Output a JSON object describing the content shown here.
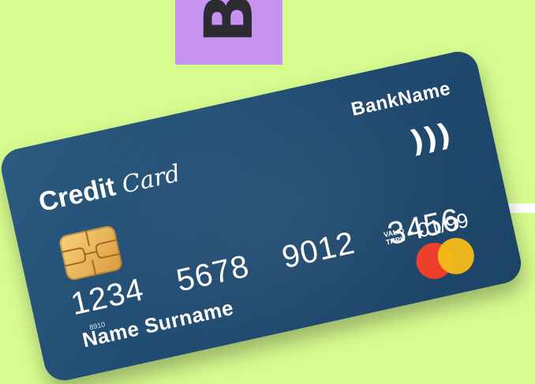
{
  "backdrop": {
    "accent_colors": {
      "lime": "#d6fb8f",
      "purple": "#c792f2"
    },
    "letter": "B"
  },
  "card": {
    "title_bold": "Credit",
    "title_italic": "Card",
    "bank_name": "BankName",
    "contactless_icon": "contactless-icon",
    "number_groups": [
      "1234",
      "5678",
      "9012",
      "3456"
    ],
    "small_digits": "8910",
    "valid_label_line1": "VALID",
    "valid_label_line2": "THRU",
    "valid_date": "01/99",
    "cardholder": "Name Surname",
    "colors": {
      "card": "#214c71",
      "chip": "#e8b55a",
      "brand_red": "#ec3f2b",
      "brand_yellow": "#f6bd17"
    }
  }
}
